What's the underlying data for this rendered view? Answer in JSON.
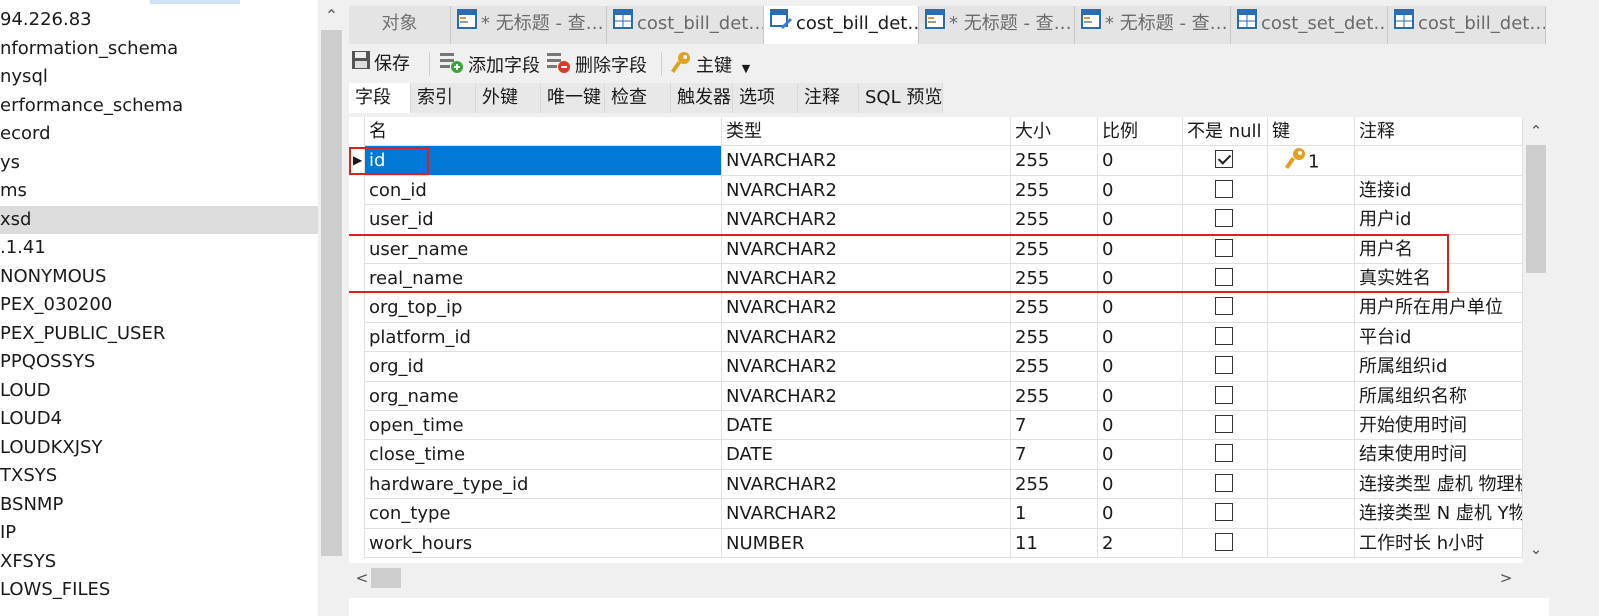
{
  "navigator": {
    "items": [
      {
        "label": "94.226.83",
        "selected": false
      },
      {
        "label": "nformation_schema",
        "selected": false
      },
      {
        "label": "nysql",
        "selected": false
      },
      {
        "label": "erformance_schema",
        "selected": false
      },
      {
        "label": "ecord",
        "selected": false
      },
      {
        "label": "ys",
        "selected": false
      },
      {
        "label": "ms",
        "selected": false
      },
      {
        "label": "xsd",
        "selected": true
      },
      {
        "label": ".1.41",
        "selected": false
      },
      {
        "label": "NONYMOUS",
        "selected": false
      },
      {
        "label": "PEX_030200",
        "selected": false
      },
      {
        "label": "PEX_PUBLIC_USER",
        "selected": false
      },
      {
        "label": "PPQOSSYS",
        "selected": false
      },
      {
        "label": "LOUD",
        "selected": false
      },
      {
        "label": "LOUD4",
        "selected": false
      },
      {
        "label": "LOUDKXJSY",
        "selected": false
      },
      {
        "label": "TXSYS",
        "selected": false
      },
      {
        "label": "BSNMP",
        "selected": false
      },
      {
        "label": "IP",
        "selected": false
      },
      {
        "label": "XFSYS",
        "selected": false
      },
      {
        "label": "LOWS_FILES",
        "selected": false
      }
    ]
  },
  "tabs": [
    {
      "label": "对象",
      "icon": "none",
      "active": false
    },
    {
      "label": "* 无标题 - 查…",
      "icon": "query-icon",
      "active": false
    },
    {
      "label": "cost_bill_det…",
      "icon": "table-icon",
      "active": false
    },
    {
      "label": "cost_bill_det…",
      "icon": "table-design-icon",
      "active": true
    },
    {
      "label": "* 无标题 - 查…",
      "icon": "query-icon",
      "active": false
    },
    {
      "label": "* 无标题 - 查…",
      "icon": "query-icon",
      "active": false
    },
    {
      "label": "cost_set_det…",
      "icon": "table-icon",
      "active": false
    },
    {
      "label": "cost_bill_det…",
      "icon": "table-icon",
      "active": false
    }
  ],
  "toolbar": {
    "save": "保存",
    "add_field": "添加字段",
    "delete_field": "删除字段",
    "primary_key": "主键"
  },
  "subtabs": [
    "字段",
    "索引",
    "外键",
    "唯一键",
    "检查",
    "触发器",
    "选项",
    "注释",
    "SQL 预览"
  ],
  "grid": {
    "headers": [
      "名",
      "类型",
      "大小",
      "比例",
      "不是 null",
      "键",
      "注释"
    ],
    "rows": [
      {
        "name": "id",
        "type": "NVARCHAR2",
        "size": "255",
        "scale": "0",
        "not_null": true,
        "key": "1",
        "comment": ""
      },
      {
        "name": "con_id",
        "type": "NVARCHAR2",
        "size": "255",
        "scale": "0",
        "not_null": false,
        "key": "",
        "comment": "连接id"
      },
      {
        "name": "user_id",
        "type": "NVARCHAR2",
        "size": "255",
        "scale": "0",
        "not_null": false,
        "key": "",
        "comment": "用户id"
      },
      {
        "name": "user_name",
        "type": "NVARCHAR2",
        "size": "255",
        "scale": "0",
        "not_null": false,
        "key": "",
        "comment": "用户名"
      },
      {
        "name": "real_name",
        "type": "NVARCHAR2",
        "size": "255",
        "scale": "0",
        "not_null": false,
        "key": "",
        "comment": "真实姓名"
      },
      {
        "name": "org_top_ip",
        "type": "NVARCHAR2",
        "size": "255",
        "scale": "0",
        "not_null": false,
        "key": "",
        "comment": "用户所在用户单位"
      },
      {
        "name": "platform_id",
        "type": "NVARCHAR2",
        "size": "255",
        "scale": "0",
        "not_null": false,
        "key": "",
        "comment": "平台id"
      },
      {
        "name": "org_id",
        "type": "NVARCHAR2",
        "size": "255",
        "scale": "0",
        "not_null": false,
        "key": "",
        "comment": "所属组织id"
      },
      {
        "name": "org_name",
        "type": "NVARCHAR2",
        "size": "255",
        "scale": "0",
        "not_null": false,
        "key": "",
        "comment": "所属组织名称"
      },
      {
        "name": "open_time",
        "type": "DATE",
        "size": "7",
        "scale": "0",
        "not_null": false,
        "key": "",
        "comment": "开始使用时间"
      },
      {
        "name": "close_time",
        "type": "DATE",
        "size": "7",
        "scale": "0",
        "not_null": false,
        "key": "",
        "comment": "结束使用时间"
      },
      {
        "name": "hardware_type_id",
        "type": "NVARCHAR2",
        "size": "255",
        "scale": "0",
        "not_null": false,
        "key": "",
        "comment": "连接类型  虚机 物理机"
      },
      {
        "name": "con_type",
        "type": "NVARCHAR2",
        "size": "1",
        "scale": "0",
        "not_null": false,
        "key": "",
        "comment": "连接类型  N 虚机 Y物"
      },
      {
        "name": "work_hours",
        "type": "NUMBER",
        "size": "11",
        "scale": "2",
        "not_null": false,
        "key": "",
        "comment": "工作时长 h小时"
      }
    ],
    "selected_row": 0
  },
  "colors": {
    "selection": "#0078d7",
    "highlight_box": "#e02020",
    "key_icon": "#e0a020"
  }
}
